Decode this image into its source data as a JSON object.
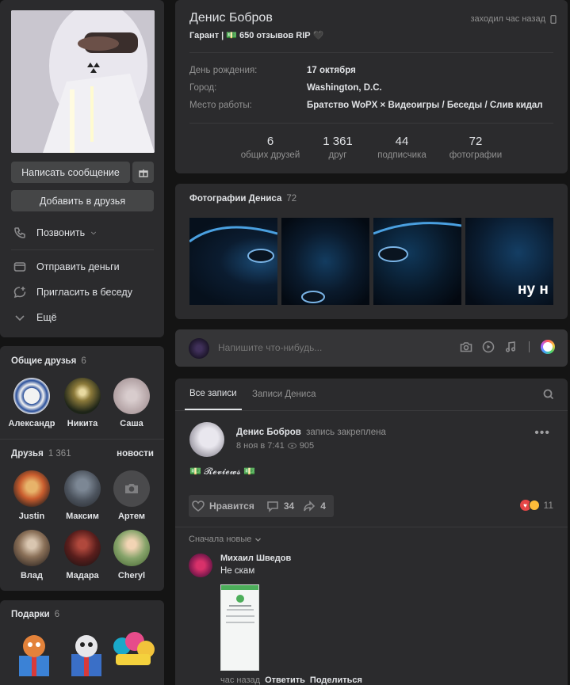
{
  "profile": {
    "name": "Денис Бобров",
    "status": "Гарант | 💵 650 отзывов RIP 🖤",
    "last_seen": "заходил час назад",
    "info": [
      {
        "label": "День рождения:",
        "value": "17 октября"
      },
      {
        "label": "Город:",
        "value": "Washington, D.C."
      },
      {
        "label": "Место работы:",
        "value": "Братство WoPX × Видеоигры / Беседы / Слив кидал"
      }
    ],
    "counters": [
      {
        "num": "6",
        "label": "общих друзей"
      },
      {
        "num": "1 361",
        "label": "друг"
      },
      {
        "num": "44",
        "label": "подписчика"
      },
      {
        "num": "72",
        "label": "фотографии"
      }
    ]
  },
  "actions": {
    "write_message": "Написать сообщение",
    "add_friend": "Добавить в друзья",
    "call": "Позвонить",
    "send_money": "Отправить деньги",
    "invite_chat": "Пригласить в беседу",
    "more": "Ещё"
  },
  "mutual": {
    "title": "Общие друзья",
    "count": "6",
    "items": [
      "Александр",
      "Никита",
      "Саша"
    ]
  },
  "friends": {
    "title": "Друзья",
    "count": "1 361",
    "news_link": "новости",
    "items": [
      "Justin",
      "Максим",
      "Артем",
      "Влад",
      "Мадара",
      "Cheryl"
    ]
  },
  "gifts": {
    "title": "Подарки",
    "count": "6"
  },
  "photos": {
    "title": "Фотографии Дениса",
    "count": "72",
    "caption": "ну н"
  },
  "composer": {
    "placeholder": "Напишите что-нибудь..."
  },
  "wall": {
    "tab_all": "Все записи",
    "tab_own": "Записи Дениса",
    "post": {
      "author": "Денис Бобров",
      "action": "запись закреплена",
      "date": "8 ноя в 7:41",
      "views": "905",
      "text": "💵 𝓡𝓮𝓿𝓲𝓮𝔀𝓼 💵",
      "like_label": "Нравится",
      "comments": "34",
      "shares": "4",
      "reactions": "11"
    },
    "sort": "Сначала новые",
    "comment": {
      "author": "Михаил Шведов",
      "text": "Не скам",
      "time": "час назад",
      "reply": "Ответить",
      "share": "Поделиться"
    }
  },
  "colors": {
    "bg": "#141414",
    "card": "#2b2b2d",
    "accent_tab": "#e1e3e6"
  }
}
